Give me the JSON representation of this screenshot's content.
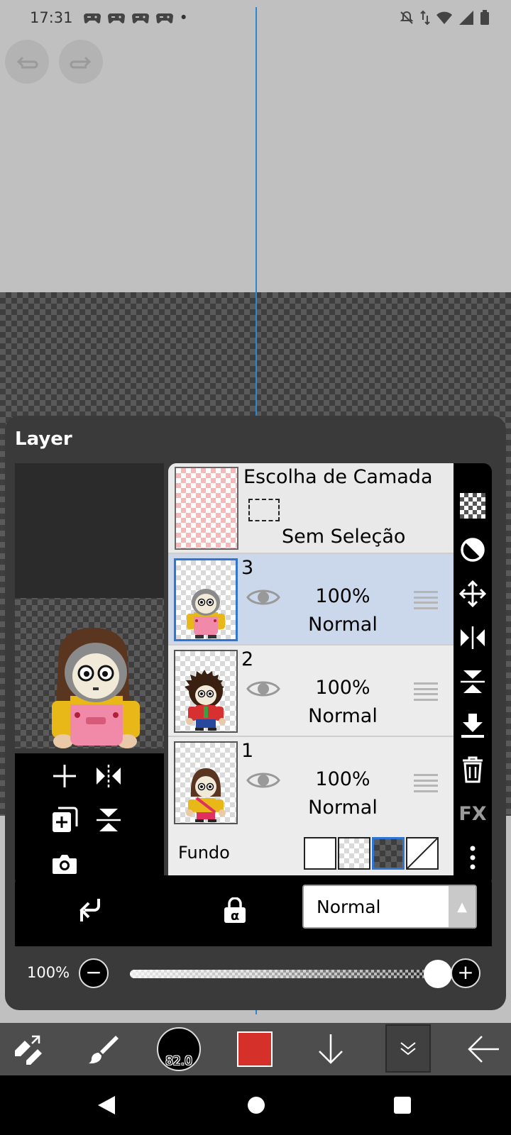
{
  "status_bar": {
    "time": "17:31",
    "notification_icons": [
      "game-controller-icon",
      "game-controller-icon",
      "game-controller-icon",
      "game-controller-icon"
    ],
    "more_dot": "•"
  },
  "layer_panel": {
    "title": "Layer",
    "selection_layer": {
      "title": "Escolha de Camada",
      "status": "Sem Seleção"
    },
    "layers": [
      {
        "number": "3",
        "opacity": "100%",
        "mode": "Normal",
        "active": true
      },
      {
        "number": "2",
        "opacity": "100%",
        "mode": "Normal",
        "active": false
      },
      {
        "number": "1",
        "opacity": "100%",
        "mode": "Normal",
        "active": false
      }
    ],
    "background": {
      "label": "Fundo",
      "options": [
        "white",
        "transparent-light",
        "transparent-dark",
        "none"
      ],
      "selected": "transparent-dark"
    },
    "side_tools": {
      "fx_label": "FX"
    },
    "blend_mode": {
      "value": "Normal"
    },
    "opacity": {
      "label": "100%",
      "value": 100,
      "minus": "−",
      "plus": "+"
    }
  },
  "toolbar": {
    "brush_size": "82.0",
    "color": "#d6302b"
  },
  "colors": {
    "accent": "#2f76d2",
    "guide_line": "#2a86d6",
    "active_layer_bg": "#cbd7ea"
  }
}
